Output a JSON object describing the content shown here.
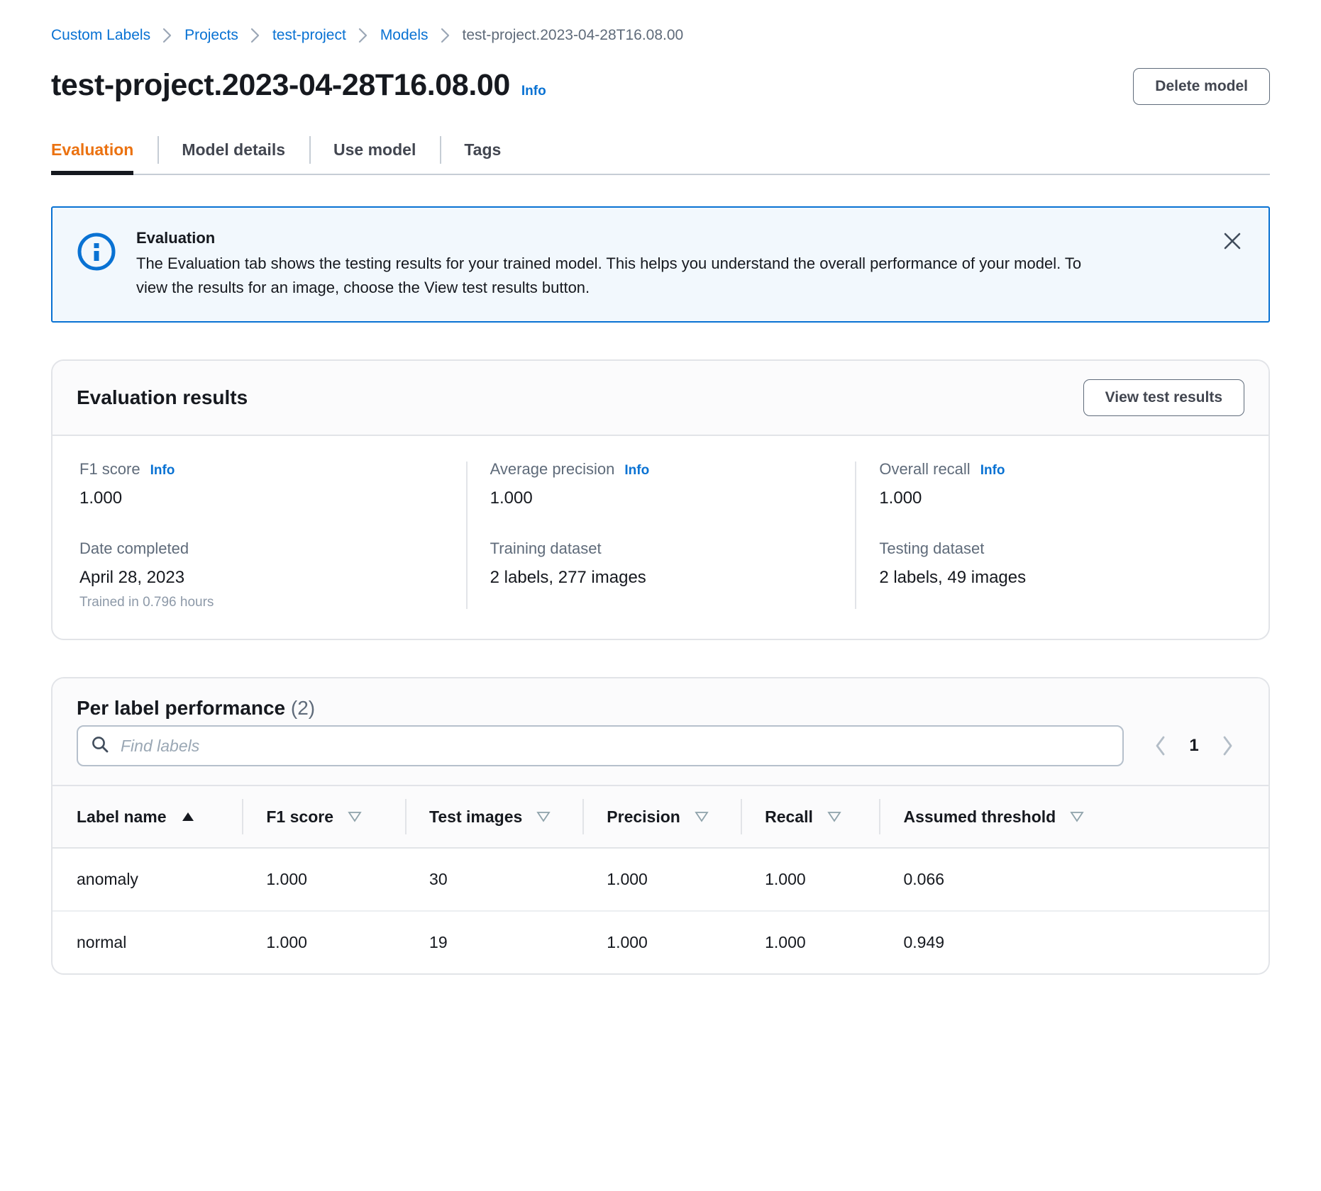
{
  "breadcrumb": {
    "items": [
      {
        "label": "Custom Labels",
        "type": "link"
      },
      {
        "label": "Projects",
        "type": "link"
      },
      {
        "label": "test-project",
        "type": "link"
      },
      {
        "label": "Models",
        "type": "link"
      },
      {
        "label": "test-project.2023-04-28T16.08.00",
        "type": "current"
      }
    ]
  },
  "header": {
    "title": "test-project.2023-04-28T16.08.00",
    "info_label": "Info",
    "delete_button": "Delete model"
  },
  "tabs": [
    {
      "label": "Evaluation",
      "active": true
    },
    {
      "label": "Model details",
      "active": false
    },
    {
      "label": "Use model",
      "active": false
    },
    {
      "label": "Tags",
      "active": false
    }
  ],
  "alert": {
    "icon": "info-circle-icon",
    "title": "Evaluation",
    "text": "The Evaluation tab shows the testing results for your trained model. This helps you understand the overall performance of your model. To view the results for an image, choose the View test results button.",
    "close_icon": "close-icon",
    "border_color": "#0972d3",
    "background_color": "#f2f8fd"
  },
  "evaluation_results": {
    "title": "Evaluation results",
    "view_button": "View test results",
    "metrics": [
      {
        "label": "F1 score",
        "info": "Info",
        "value": "1.000",
        "second_label": "Date completed",
        "second_value": "April 28, 2023",
        "second_sub": "Trained in 0.796 hours"
      },
      {
        "label": "Average precision",
        "info": "Info",
        "value": "1.000",
        "second_label": "Training dataset",
        "second_value": "2 labels, 277 images",
        "second_sub": ""
      },
      {
        "label": "Overall recall",
        "info": "Info",
        "value": "1.000",
        "second_label": "Testing dataset",
        "second_value": "2 labels, 49 images",
        "second_sub": ""
      }
    ]
  },
  "per_label": {
    "title": "Per label performance",
    "count": "(2)",
    "search_placeholder": "Find labels",
    "search_value": "",
    "search_icon": "search-icon",
    "pagination": {
      "prev_icon": "chevron-left-icon",
      "next_icon": "chevron-right-icon",
      "current_page": "1"
    },
    "columns": [
      {
        "label": "Label name",
        "sort": "asc"
      },
      {
        "label": "F1 score",
        "sort": "none"
      },
      {
        "label": "Test images",
        "sort": "none"
      },
      {
        "label": "Precision",
        "sort": "none"
      },
      {
        "label": "Recall",
        "sort": "none"
      },
      {
        "label": "Assumed threshold",
        "sort": "none"
      }
    ],
    "rows": [
      {
        "label_name": "anomaly",
        "f1_score": "1.000",
        "test_images": "30",
        "precision": "1.000",
        "recall": "1.000",
        "assumed_threshold": "0.066"
      },
      {
        "label_name": "normal",
        "f1_score": "1.000",
        "test_images": "19",
        "precision": "1.000",
        "recall": "1.000",
        "assumed_threshold": "0.949"
      }
    ]
  },
  "colors": {
    "accent_orange": "#eb7211",
    "link_blue": "#0972d3",
    "text_dark": "#16191f",
    "text_muted": "#5f6b7a",
    "border": "#e2e4e8"
  }
}
